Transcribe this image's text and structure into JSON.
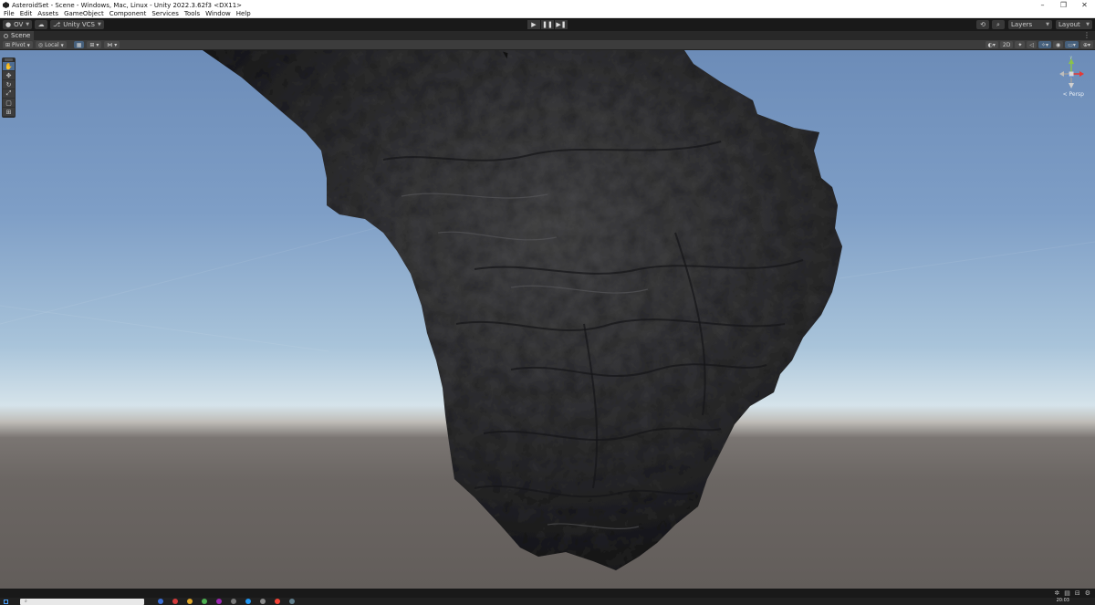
{
  "window": {
    "title": "AsteroidSet - Scene - Windows, Mac, Linux - Unity 2022.3.62f3 <DX11>",
    "controls": [
      "–",
      "❐",
      "✕"
    ]
  },
  "menu": [
    "File",
    "Edit",
    "Assets",
    "GameObject",
    "Component",
    "Services",
    "Tools",
    "Window",
    "Help"
  ],
  "toolbar": {
    "account": "OV",
    "vcs": "Unity VCS",
    "layers": "Layers",
    "layout": "Layout",
    "play_icons": [
      "▶",
      "❚❚",
      "▶❚"
    ]
  },
  "scene_tab": {
    "label": "Scene"
  },
  "scene_toolbar": {
    "pivot": "Pivot",
    "space": "Local",
    "mode_2d": "2D"
  },
  "viewport": {
    "projection": "< Persp",
    "gizmo_axes": [
      "y",
      "x",
      "z"
    ]
  },
  "taskbar": {
    "search_placeholder": "",
    "clock": "20:03"
  },
  "colors": {
    "editor_bg": "#191919",
    "panel": "#3c3c3c",
    "accent": "#46607c",
    "sky_top": "#6c8cb8",
    "horizon": "#d5e3ea",
    "ground": "#6b6663",
    "rock": "#2f2f31"
  }
}
